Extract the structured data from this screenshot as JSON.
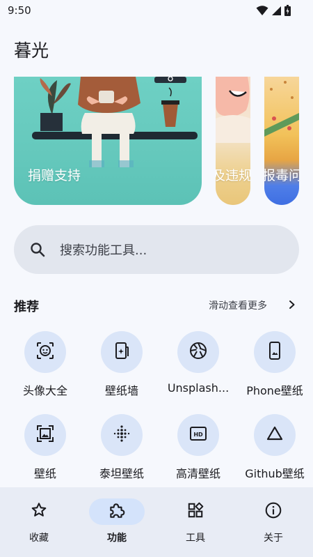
{
  "status_bar": {
    "time": "9:50",
    "icons": [
      "wifi-icon",
      "cellular-signal-icon",
      "battery-charging-icon"
    ]
  },
  "app": {
    "title": "暮光"
  },
  "banners": [
    {
      "label": "捐赠支持"
    },
    {
      "label": "及违规"
    },
    {
      "label": "报毒问"
    }
  ],
  "search": {
    "placeholder": "搜索功能工具..."
  },
  "recommend": {
    "title": "推荐",
    "more_label": "滑动查看更多",
    "items": [
      {
        "label": "头像大全",
        "icon": "face-avatar-icon"
      },
      {
        "label": "壁纸墙",
        "icon": "wallpaper-wall-icon"
      },
      {
        "label": "Unsplash...",
        "icon": "camera-shutter-icon"
      },
      {
        "label": "Phone壁纸",
        "icon": "phone-wallpaper-icon"
      },
      {
        "label": "壁纸",
        "icon": "image-frame-icon"
      },
      {
        "label": "泰坦壁纸",
        "icon": "dot-grid-icon"
      },
      {
        "label": "高清壁纸",
        "icon": "hd-icon"
      },
      {
        "label": "Github壁纸",
        "icon": "triangle-icon"
      }
    ]
  },
  "nav": {
    "items": [
      {
        "label": "收藏",
        "icon": "star-icon",
        "active": false
      },
      {
        "label": "功能",
        "icon": "puzzle-icon",
        "active": true
      },
      {
        "label": "工具",
        "icon": "widgets-icon",
        "active": false
      },
      {
        "label": "关于",
        "icon": "info-icon",
        "active": false
      }
    ]
  },
  "colors": {
    "background": "#f6f8fd",
    "tile_circle": "#dae5f8",
    "nav_background": "#e8ecf5",
    "nav_active_pill": "#d4e3fb",
    "search_background": "#e2e6ee"
  }
}
